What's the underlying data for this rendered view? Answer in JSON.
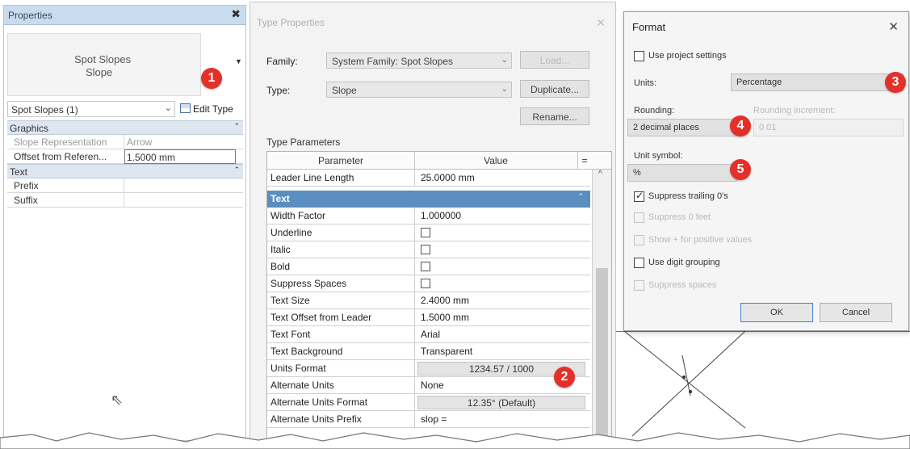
{
  "properties": {
    "title": "Properties",
    "close": "✖",
    "preview": {
      "family": "Spot Slopes",
      "type": "Slope",
      "arrow": "▼"
    },
    "selector": {
      "value": "Spot Slopes (1)",
      "arrow": "⌄"
    },
    "edit_type": "Edit Type",
    "groups": [
      {
        "name": "Graphics",
        "collapse": "⌃"
      },
      {
        "name": "Text",
        "collapse": "⌃"
      }
    ],
    "rows": [
      {
        "name": "Slope Representation",
        "value": "Arrow"
      },
      {
        "name": "Offset from Referen...",
        "value": "1.5000 mm"
      },
      {
        "name": "Prefix",
        "value": ""
      },
      {
        "name": "Suffix",
        "value": ""
      }
    ]
  },
  "type_properties": {
    "title": "Type Properties",
    "close": "✕",
    "family_label": "Family:",
    "family_value": "System Family: Spot Slopes",
    "type_label": "Type:",
    "type_value": "Slope",
    "load_button": "Load...",
    "duplicate_button": "Duplicate...",
    "rename_button": "Rename...",
    "params_label": "Type Parameters",
    "header": {
      "parameter": "Parameter",
      "value": "Value",
      "eq": "="
    },
    "top_row": {
      "name": "Leader Line Length",
      "value": "25.0000 mm"
    },
    "group_text": "Text",
    "rows": [
      {
        "name": "Width Factor",
        "value": "1.000000"
      },
      {
        "name": "Underline",
        "value": ""
      },
      {
        "name": "Italic",
        "value": ""
      },
      {
        "name": "Bold",
        "value": ""
      },
      {
        "name": "Suppress Spaces",
        "value": ""
      },
      {
        "name": "Text Size",
        "value": "2.4000 mm"
      },
      {
        "name": "Text Offset from Leader",
        "value": "1.5000 mm"
      },
      {
        "name": "Text Font",
        "value": "Arial"
      },
      {
        "name": "Text Background",
        "value": "Transparent"
      },
      {
        "name": "Units Format",
        "value": "1234.57 / 1000"
      },
      {
        "name": "Alternate Units",
        "value": "None"
      },
      {
        "name": "Alternate Units Format",
        "value": "12.35° (Default)"
      },
      {
        "name": "Alternate Units Prefix",
        "value": "slop ="
      }
    ]
  },
  "format": {
    "title": "Format",
    "close": "✕",
    "use_project_settings": "Use project settings",
    "units_label": "Units:",
    "units_value": "Percentage",
    "rounding_label": "Rounding:",
    "rounding_value": "2 decimal places",
    "rounding_increment_label": "Rounding increment:",
    "rounding_increment_value": "0.01",
    "unit_symbol_label": "Unit symbol:",
    "unit_symbol_value": "%",
    "suppress_trailing": "Suppress trailing 0's",
    "suppress_0_feet": "Suppress 0 feet",
    "show_plus": "Show + for positive values",
    "use_digit_grouping": "Use digit grouping",
    "suppress_spaces": "Suppress spaces",
    "ok": "OK",
    "cancel": "Cancel",
    "check_mark": "✓"
  },
  "badges": [
    "1",
    "2",
    "3",
    "4",
    "5"
  ],
  "icons": {
    "cursor": "⇖",
    "scroll_up": "^"
  },
  "colors": {
    "badge": "#e4302a",
    "group_header": "#5b8ec0",
    "palette_title": "#c9dcee"
  }
}
